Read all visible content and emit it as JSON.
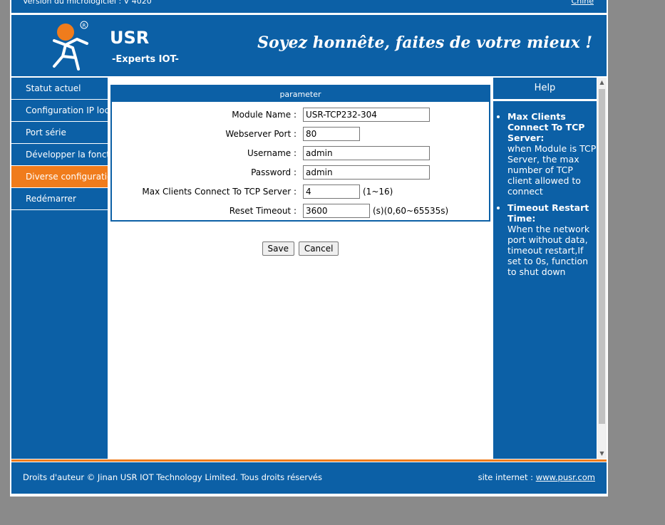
{
  "topbar": {
    "version": "Version du micrologiciel : V 4020",
    "language": "Chine"
  },
  "header": {
    "brand": "USR",
    "subtitle": "-Experts IOT-",
    "slogan": "Soyez honnête, faites de votre mieux !",
    "logo_icon": "usr-logo-icon"
  },
  "nav": {
    "items": [
      {
        "label": "Statut actuel"
      },
      {
        "label": "Configuration IP locale"
      },
      {
        "label": "Port série"
      },
      {
        "label": "Développer la fonction"
      },
      {
        "label": "Diverse configuration"
      },
      {
        "label": "Redémarrer"
      }
    ],
    "active_index": 4
  },
  "form": {
    "title": "parameter",
    "module_name": {
      "label": "Module Name :",
      "value": "USR-TCP232-304"
    },
    "webserver_port": {
      "label": "Webserver Port :",
      "value": "80"
    },
    "username": {
      "label": "Username :",
      "value": "admin"
    },
    "password": {
      "label": "Password :",
      "value": "admin"
    },
    "max_clients": {
      "label": "Max Clients Connect To TCP Server :",
      "value": "4",
      "hint": "(1~16)"
    },
    "reset_timeout": {
      "label": "Reset Timeout :",
      "value": "3600",
      "hint": "(s)(0,60~65535s)"
    },
    "save_label": "Save",
    "cancel_label": "Cancel"
  },
  "help": {
    "title": "Help",
    "items": [
      {
        "heading": "Max Clients Connect To TCP Server:",
        "text": "when Module is TCP Server, the max number of TCP client allowed to connect"
      },
      {
        "heading": "Timeout Restart Time:",
        "text": "When the network port without data, timeout restart,If set to 0s, function to shut down"
      }
    ]
  },
  "footer": {
    "copyright": "Droits d'auteur © Jinan USR IOT Technology Limited. Tous droits réservés",
    "site_label": "site internet :",
    "site_link": "www.pusr.com"
  },
  "colors": {
    "primary": "#0c60a6",
    "accent": "#f07c1c",
    "background": "#8a8a8a"
  }
}
